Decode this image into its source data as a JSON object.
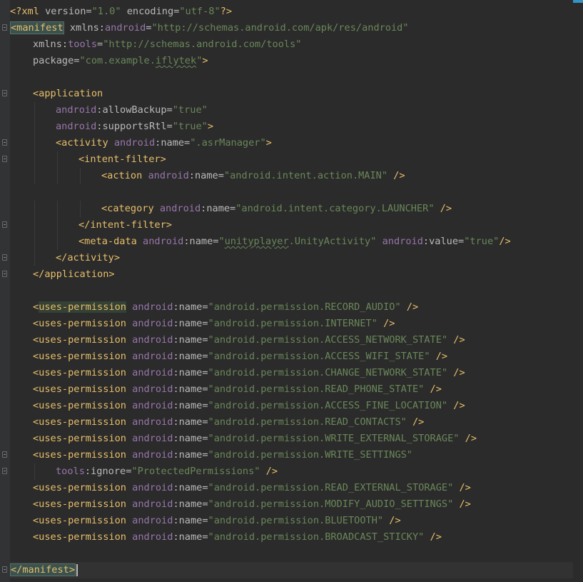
{
  "editor": {
    "lines": [
      {
        "indent": 0,
        "fold": false,
        "current": false,
        "tokens": [
          {
            "t": "pi",
            "v": "<?xml "
          },
          {
            "t": "attr",
            "v": "version="
          },
          {
            "t": "val",
            "v": "\"1.0\""
          },
          {
            "t": "attr",
            "v": " encoding="
          },
          {
            "t": "val",
            "v": "\"utf-8\""
          },
          {
            "t": "pi",
            "v": "?>"
          }
        ]
      },
      {
        "indent": 0,
        "fold": true,
        "current": false,
        "tokens": [
          {
            "t": "tag hl-match",
            "v": "<manifest"
          },
          {
            "t": "attr",
            "v": " xmlns:"
          },
          {
            "t": "ns",
            "v": "android"
          },
          {
            "t": "attr",
            "v": "="
          },
          {
            "t": "val",
            "v": "\"http://schemas.android.com/apk/res/android\""
          }
        ]
      },
      {
        "indent": 1,
        "fold": false,
        "current": false,
        "tokens": [
          {
            "t": "attr",
            "v": "xmlns:"
          },
          {
            "t": "ns",
            "v": "tools"
          },
          {
            "t": "attr",
            "v": "="
          },
          {
            "t": "val",
            "v": "\"http://schemas.android.com/tools\""
          }
        ]
      },
      {
        "indent": 1,
        "fold": false,
        "current": false,
        "tokens": [
          {
            "t": "attr",
            "v": "package="
          },
          {
            "t": "val",
            "v": "\"com.example."
          },
          {
            "t": "val typo",
            "v": "iflytek"
          },
          {
            "t": "val",
            "v": "\""
          },
          {
            "t": "tag",
            "v": ">"
          }
        ]
      },
      {
        "indent": 0,
        "fold": false,
        "current": false,
        "tokens": []
      },
      {
        "indent": 1,
        "fold": true,
        "current": false,
        "tokens": [
          {
            "t": "tag",
            "v": "<application"
          }
        ]
      },
      {
        "indent": 2,
        "fold": false,
        "current": false,
        "tokens": [
          {
            "t": "ns",
            "v": "android"
          },
          {
            "t": "attr",
            "v": ":allowBackup="
          },
          {
            "t": "val",
            "v": "\"true\""
          }
        ]
      },
      {
        "indent": 2,
        "fold": false,
        "current": false,
        "tokens": [
          {
            "t": "ns",
            "v": "android"
          },
          {
            "t": "attr",
            "v": ":supportsRtl="
          },
          {
            "t": "val",
            "v": "\"true\""
          },
          {
            "t": "tag",
            "v": ">"
          }
        ]
      },
      {
        "indent": 2,
        "fold": true,
        "current": false,
        "tokens": [
          {
            "t": "tag",
            "v": "<activity "
          },
          {
            "t": "ns",
            "v": "android"
          },
          {
            "t": "attr",
            "v": ":name="
          },
          {
            "t": "val",
            "v": "\".asrManager\""
          },
          {
            "t": "tag",
            "v": ">"
          }
        ]
      },
      {
        "indent": 3,
        "fold": true,
        "current": false,
        "tokens": [
          {
            "t": "tag",
            "v": "<intent-filter>"
          }
        ]
      },
      {
        "indent": 4,
        "fold": false,
        "current": false,
        "tokens": [
          {
            "t": "tag",
            "v": "<action "
          },
          {
            "t": "ns",
            "v": "android"
          },
          {
            "t": "attr",
            "v": ":name="
          },
          {
            "t": "val",
            "v": "\"android.intent.action.MAIN\""
          },
          {
            "t": "tag",
            "v": " />"
          }
        ]
      },
      {
        "indent": 0,
        "fold": false,
        "current": false,
        "tokens": []
      },
      {
        "indent": 4,
        "fold": false,
        "current": false,
        "tokens": [
          {
            "t": "tag",
            "v": "<category "
          },
          {
            "t": "ns",
            "v": "android"
          },
          {
            "t": "attr",
            "v": ":name="
          },
          {
            "t": "val",
            "v": "\"android.intent.category.LAUNCHER\""
          },
          {
            "t": "tag",
            "v": " />"
          }
        ]
      },
      {
        "indent": 3,
        "fold": true,
        "current": false,
        "tokens": [
          {
            "t": "tag",
            "v": "</intent-filter>"
          }
        ]
      },
      {
        "indent": 3,
        "fold": false,
        "current": false,
        "tokens": [
          {
            "t": "tag",
            "v": "<meta-data "
          },
          {
            "t": "ns",
            "v": "android"
          },
          {
            "t": "attr",
            "v": ":name="
          },
          {
            "t": "val",
            "v": "\""
          },
          {
            "t": "val typo",
            "v": "unityplayer"
          },
          {
            "t": "val",
            "v": ".UnityActivity\""
          },
          {
            "t": "attr",
            "v": " "
          },
          {
            "t": "ns",
            "v": "android"
          },
          {
            "t": "attr",
            "v": ":value="
          },
          {
            "t": "val",
            "v": "\"true\""
          },
          {
            "t": "tag",
            "v": "/>"
          }
        ]
      },
      {
        "indent": 2,
        "fold": true,
        "current": false,
        "tokens": [
          {
            "t": "tag",
            "v": "</activity>"
          }
        ]
      },
      {
        "indent": 1,
        "fold": true,
        "current": false,
        "tokens": [
          {
            "t": "tag",
            "v": "</application>"
          }
        ]
      },
      {
        "indent": 0,
        "fold": false,
        "current": false,
        "tokens": []
      },
      {
        "indent": 1,
        "fold": false,
        "current": false,
        "tokens": [
          {
            "t": "tag",
            "v": "<"
          },
          {
            "t": "tag hl-usage",
            "v": "uses-permission"
          },
          {
            "t": "attr",
            "v": " "
          },
          {
            "t": "ns",
            "v": "android"
          },
          {
            "t": "attr",
            "v": ":name="
          },
          {
            "t": "val",
            "v": "\"android.permission.RECORD_AUDIO\""
          },
          {
            "t": "tag",
            "v": " />"
          }
        ]
      },
      {
        "indent": 1,
        "fold": false,
        "current": false,
        "tokens": [
          {
            "t": "tag",
            "v": "<uses-permission "
          },
          {
            "t": "ns",
            "v": "android"
          },
          {
            "t": "attr",
            "v": ":name="
          },
          {
            "t": "val",
            "v": "\"android.permission.INTERNET\""
          },
          {
            "t": "tag",
            "v": " />"
          }
        ]
      },
      {
        "indent": 1,
        "fold": false,
        "current": false,
        "tokens": [
          {
            "t": "tag",
            "v": "<uses-permission "
          },
          {
            "t": "ns",
            "v": "android"
          },
          {
            "t": "attr",
            "v": ":name="
          },
          {
            "t": "val",
            "v": "\"android.permission.ACCESS_NETWORK_STATE\""
          },
          {
            "t": "tag",
            "v": " />"
          }
        ]
      },
      {
        "indent": 1,
        "fold": false,
        "current": false,
        "tokens": [
          {
            "t": "tag",
            "v": "<uses-permission "
          },
          {
            "t": "ns",
            "v": "android"
          },
          {
            "t": "attr",
            "v": ":name="
          },
          {
            "t": "val",
            "v": "\"android.permission.ACCESS_WIFI_STATE\""
          },
          {
            "t": "tag",
            "v": " />"
          }
        ]
      },
      {
        "indent": 1,
        "fold": false,
        "current": false,
        "tokens": [
          {
            "t": "tag",
            "v": "<uses-permission "
          },
          {
            "t": "ns",
            "v": "android"
          },
          {
            "t": "attr",
            "v": ":name="
          },
          {
            "t": "val",
            "v": "\"android.permission.CHANGE_NETWORK_STATE\""
          },
          {
            "t": "tag",
            "v": " />"
          }
        ]
      },
      {
        "indent": 1,
        "fold": false,
        "current": false,
        "tokens": [
          {
            "t": "tag",
            "v": "<uses-permission "
          },
          {
            "t": "ns",
            "v": "android"
          },
          {
            "t": "attr",
            "v": ":name="
          },
          {
            "t": "val",
            "v": "\"android.permission.READ_PHONE_STATE\""
          },
          {
            "t": "tag",
            "v": " />"
          }
        ]
      },
      {
        "indent": 1,
        "fold": false,
        "current": false,
        "tokens": [
          {
            "t": "tag",
            "v": "<uses-permission "
          },
          {
            "t": "ns",
            "v": "android"
          },
          {
            "t": "attr",
            "v": ":name="
          },
          {
            "t": "val",
            "v": "\"android.permission.ACCESS_FINE_LOCATION\""
          },
          {
            "t": "tag",
            "v": " />"
          }
        ]
      },
      {
        "indent": 1,
        "fold": false,
        "current": false,
        "tokens": [
          {
            "t": "tag",
            "v": "<uses-permission "
          },
          {
            "t": "ns",
            "v": "android"
          },
          {
            "t": "attr",
            "v": ":name="
          },
          {
            "t": "val",
            "v": "\"android.permission.READ_CONTACTS\""
          },
          {
            "t": "tag",
            "v": " />"
          }
        ]
      },
      {
        "indent": 1,
        "fold": false,
        "current": false,
        "tokens": [
          {
            "t": "tag",
            "v": "<uses-permission "
          },
          {
            "t": "ns",
            "v": "android"
          },
          {
            "t": "attr",
            "v": ":name="
          },
          {
            "t": "val",
            "v": "\"android.permission.WRITE_EXTERNAL_STORAGE\""
          },
          {
            "t": "tag",
            "v": " />"
          }
        ]
      },
      {
        "indent": 1,
        "fold": true,
        "current": false,
        "tokens": [
          {
            "t": "tag",
            "v": "<uses-permission "
          },
          {
            "t": "ns",
            "v": "android"
          },
          {
            "t": "attr",
            "v": ":name="
          },
          {
            "t": "val",
            "v": "\"android.permission.WRITE_SETTINGS\""
          }
        ]
      },
      {
        "indent": 2,
        "fold": true,
        "current": false,
        "tokens": [
          {
            "t": "ns",
            "v": "tools"
          },
          {
            "t": "attr",
            "v": ":ignore="
          },
          {
            "t": "val",
            "v": "\"ProtectedPermissions\""
          },
          {
            "t": "tag",
            "v": " />"
          }
        ]
      },
      {
        "indent": 1,
        "fold": false,
        "current": false,
        "tokens": [
          {
            "t": "tag",
            "v": "<uses-permission "
          },
          {
            "t": "ns",
            "v": "android"
          },
          {
            "t": "attr",
            "v": ":name="
          },
          {
            "t": "val",
            "v": "\"android.permission.READ_EXTERNAL_STORAGE\""
          },
          {
            "t": "tag",
            "v": " />"
          }
        ]
      },
      {
        "indent": 1,
        "fold": false,
        "current": false,
        "tokens": [
          {
            "t": "tag",
            "v": "<uses-permission "
          },
          {
            "t": "ns",
            "v": "android"
          },
          {
            "t": "attr",
            "v": ":name="
          },
          {
            "t": "val",
            "v": "\"android.permission.MODIFY_AUDIO_SETTINGS\""
          },
          {
            "t": "tag",
            "v": " />"
          }
        ]
      },
      {
        "indent": 1,
        "fold": false,
        "current": false,
        "tokens": [
          {
            "t": "tag",
            "v": "<uses-permission "
          },
          {
            "t": "ns",
            "v": "android"
          },
          {
            "t": "attr",
            "v": ":name="
          },
          {
            "t": "val",
            "v": "\"android.permission.BLUETOOTH\""
          },
          {
            "t": "tag",
            "v": " />"
          }
        ]
      },
      {
        "indent": 1,
        "fold": false,
        "current": false,
        "tokens": [
          {
            "t": "tag",
            "v": "<uses-permission "
          },
          {
            "t": "ns",
            "v": "android"
          },
          {
            "t": "attr",
            "v": ":name="
          },
          {
            "t": "val",
            "v": "\"android.permission.BROADCAST_STICKY\""
          },
          {
            "t": "tag",
            "v": " />"
          }
        ]
      },
      {
        "indent": 0,
        "fold": false,
        "current": false,
        "tokens": []
      },
      {
        "indent": 0,
        "fold": true,
        "current": true,
        "caret": true,
        "tokens": [
          {
            "t": "tag hl-match",
            "v": "</manifest>"
          }
        ]
      }
    ]
  },
  "colors": {
    "background": "#2b2b2b",
    "tag": "#e8bf6a",
    "attribute": "#bababa",
    "namespace": "#9876aa",
    "string": "#6a8759"
  }
}
